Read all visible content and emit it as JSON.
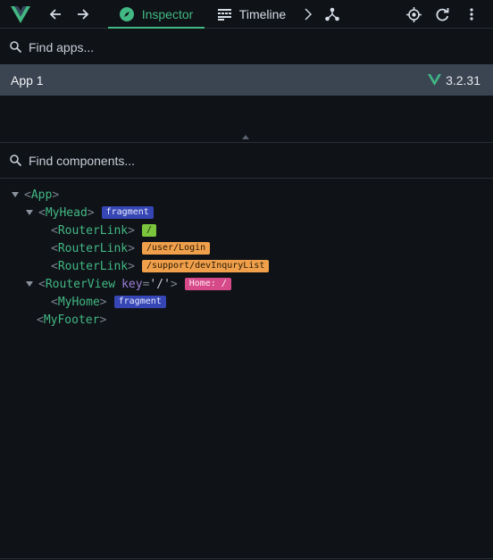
{
  "toolbar": {
    "inspector_label": "Inspector",
    "timeline_label": "Timeline"
  },
  "apps": {
    "search_placeholder": "Find apps...",
    "items": [
      {
        "name": "App 1",
        "version": "3.2.31"
      }
    ]
  },
  "components": {
    "search_placeholder": "Find components...",
    "tree": {
      "app": "App",
      "my_head": "MyHead",
      "my_head_badge": "fragment",
      "router_link": "RouterLink",
      "link_badge_1": "/",
      "link_badge_2": "/user/Login",
      "link_badge_3": "/support/devInquryList",
      "router_view": "RouterView",
      "router_view_key_name": "key",
      "router_view_key_value": "'/'",
      "router_view_badge": "Home: /",
      "my_home": "MyHome",
      "my_home_badge": "fragment",
      "my_footer": "MyFooter"
    }
  },
  "colors": {
    "accent": "#42b883",
    "selected_row": "#3b4451",
    "background": "#0f1217"
  },
  "icons": {
    "logo": "vue-logo-icon",
    "back": "arrow-left-icon",
    "forward": "arrow-right-icon",
    "inspector": "compass-icon",
    "timeline": "timeline-icon",
    "more_tabs": "chevron-right-icon",
    "graph": "component-graph-icon",
    "select": "crosshair-icon",
    "refresh": "refresh-icon",
    "menu": "more-vertical-icon",
    "search": "search-icon"
  }
}
